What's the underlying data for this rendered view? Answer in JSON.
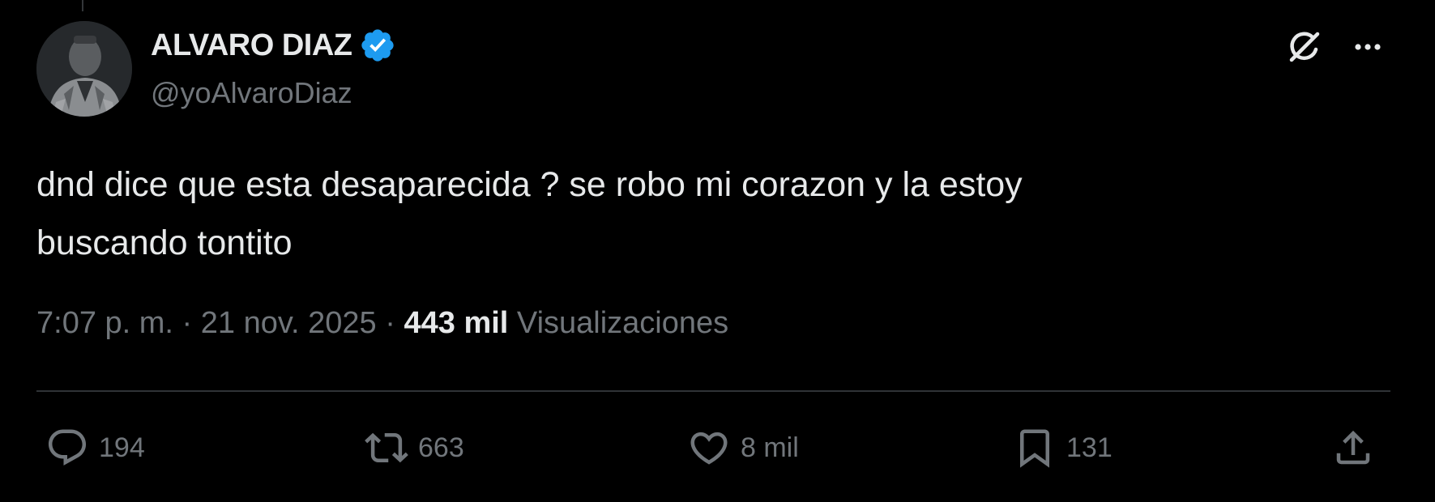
{
  "tweet": {
    "author": {
      "display_name": "ALVARO DIAZ",
      "handle": "@yoAlvaroDiaz",
      "verified": true
    },
    "text": "dnd dice que esta desaparecida ? se robo mi corazon y la estoy\nbuscando tontito",
    "time": "7:07 p. m.",
    "separator": "·",
    "date": "21 nov. 2025",
    "views_count": "443 mil",
    "views_label": "Visualizaciones",
    "stats": {
      "replies": "194",
      "reposts": "663",
      "likes": "8 mil",
      "bookmarks": "131"
    }
  },
  "icons": {
    "verified": "verified-badge-icon",
    "grok": "grok-icon",
    "more": "more-horizontal-icon",
    "reply": "reply-icon",
    "repost": "repost-icon",
    "like": "heart-icon",
    "bookmark": "bookmark-icon",
    "share": "share-icon"
  },
  "colors": {
    "background": "#000000",
    "primary_text": "#e7e9ea",
    "secondary_text": "#71767b",
    "divider": "#2f3336",
    "verified_blue": "#1d9bf0"
  }
}
